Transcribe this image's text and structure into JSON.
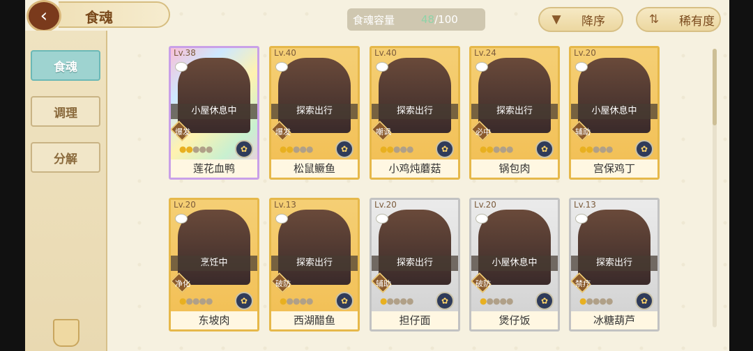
{
  "header": {
    "title": "食魂"
  },
  "capacity": {
    "label": "食魂容量",
    "count": "48",
    "sep": "/",
    "max": "100",
    "count_color": "#8fd3a8"
  },
  "sort": {
    "label": "降序",
    "icon": "triangle-down-icon"
  },
  "rarity": {
    "label": "稀有度",
    "icon": "sort-arrows-icon"
  },
  "sidebar": {
    "items": [
      {
        "label": "食魂",
        "active": true
      },
      {
        "label": "调理",
        "active": false
      },
      {
        "label": "分解",
        "active": false
      }
    ]
  },
  "cards": [
    {
      "level": "Lv.38",
      "status": "小屋休息中",
      "role": "爆发",
      "name": "莲花血鸭",
      "stars": 2,
      "frame": "rainbow"
    },
    {
      "level": "Lv.40",
      "status": "探索出行",
      "role": "爆发",
      "name": "松鼠鳜鱼",
      "stars": 2,
      "frame": "gold"
    },
    {
      "level": "Lv.40",
      "status": "探索出行",
      "role": "嘲讽",
      "name": "小鸡炖蘑菇",
      "stars": 2,
      "frame": "gold"
    },
    {
      "level": "Lv.24",
      "status": "探索出行",
      "role": "必中",
      "name": "锅包肉",
      "stars": 2,
      "frame": "gold"
    },
    {
      "level": "Lv.20",
      "status": "小屋休息中",
      "role": "辅助",
      "name": "宫保鸡丁",
      "stars": 2,
      "frame": "gold"
    },
    {
      "level": "Lv.20",
      "status": "烹饪中",
      "role": "净化",
      "name": "东坡肉",
      "stars": 1,
      "frame": "gold"
    },
    {
      "level": "Lv.13",
      "status": "探索出行",
      "role": "破防",
      "name": "西湖醋鱼",
      "stars": 1,
      "frame": "gold"
    },
    {
      "level": "Lv.20",
      "status": "探索出行",
      "role": "辅助",
      "name": "担仔面",
      "stars": 1,
      "frame": "silver"
    },
    {
      "level": "Lv.20",
      "status": "小屋休息中",
      "role": "破防",
      "name": "煲仔饭",
      "stars": 1,
      "frame": "silver"
    },
    {
      "level": "Lv.13",
      "status": "探索出行",
      "role": "禁疗",
      "name": "冰糖葫芦",
      "stars": 1,
      "frame": "silver"
    }
  ]
}
